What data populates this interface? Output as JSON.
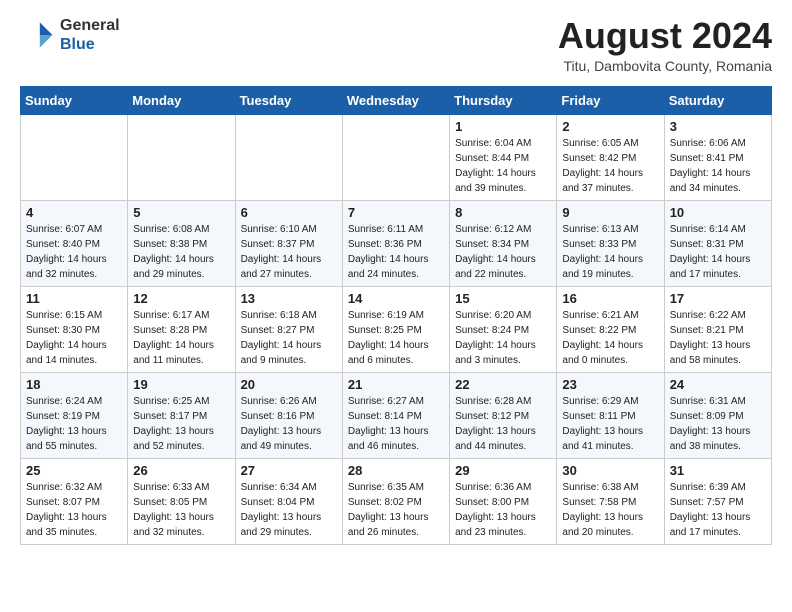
{
  "header": {
    "logo_line1": "General",
    "logo_line2": "Blue",
    "month_year": "August 2024",
    "location": "Titu, Dambovita County, Romania"
  },
  "days_of_week": [
    "Sunday",
    "Monday",
    "Tuesday",
    "Wednesday",
    "Thursday",
    "Friday",
    "Saturday"
  ],
  "weeks": [
    [
      {
        "day": "",
        "info": ""
      },
      {
        "day": "",
        "info": ""
      },
      {
        "day": "",
        "info": ""
      },
      {
        "day": "",
        "info": ""
      },
      {
        "day": "1",
        "info": "Sunrise: 6:04 AM\nSunset: 8:44 PM\nDaylight: 14 hours\nand 39 minutes."
      },
      {
        "day": "2",
        "info": "Sunrise: 6:05 AM\nSunset: 8:42 PM\nDaylight: 14 hours\nand 37 minutes."
      },
      {
        "day": "3",
        "info": "Sunrise: 6:06 AM\nSunset: 8:41 PM\nDaylight: 14 hours\nand 34 minutes."
      }
    ],
    [
      {
        "day": "4",
        "info": "Sunrise: 6:07 AM\nSunset: 8:40 PM\nDaylight: 14 hours\nand 32 minutes."
      },
      {
        "day": "5",
        "info": "Sunrise: 6:08 AM\nSunset: 8:38 PM\nDaylight: 14 hours\nand 29 minutes."
      },
      {
        "day": "6",
        "info": "Sunrise: 6:10 AM\nSunset: 8:37 PM\nDaylight: 14 hours\nand 27 minutes."
      },
      {
        "day": "7",
        "info": "Sunrise: 6:11 AM\nSunset: 8:36 PM\nDaylight: 14 hours\nand 24 minutes."
      },
      {
        "day": "8",
        "info": "Sunrise: 6:12 AM\nSunset: 8:34 PM\nDaylight: 14 hours\nand 22 minutes."
      },
      {
        "day": "9",
        "info": "Sunrise: 6:13 AM\nSunset: 8:33 PM\nDaylight: 14 hours\nand 19 minutes."
      },
      {
        "day": "10",
        "info": "Sunrise: 6:14 AM\nSunset: 8:31 PM\nDaylight: 14 hours\nand 17 minutes."
      }
    ],
    [
      {
        "day": "11",
        "info": "Sunrise: 6:15 AM\nSunset: 8:30 PM\nDaylight: 14 hours\nand 14 minutes."
      },
      {
        "day": "12",
        "info": "Sunrise: 6:17 AM\nSunset: 8:28 PM\nDaylight: 14 hours\nand 11 minutes."
      },
      {
        "day": "13",
        "info": "Sunrise: 6:18 AM\nSunset: 8:27 PM\nDaylight: 14 hours\nand 9 minutes."
      },
      {
        "day": "14",
        "info": "Sunrise: 6:19 AM\nSunset: 8:25 PM\nDaylight: 14 hours\nand 6 minutes."
      },
      {
        "day": "15",
        "info": "Sunrise: 6:20 AM\nSunset: 8:24 PM\nDaylight: 14 hours\nand 3 minutes."
      },
      {
        "day": "16",
        "info": "Sunrise: 6:21 AM\nSunset: 8:22 PM\nDaylight: 14 hours\nand 0 minutes."
      },
      {
        "day": "17",
        "info": "Sunrise: 6:22 AM\nSunset: 8:21 PM\nDaylight: 13 hours\nand 58 minutes."
      }
    ],
    [
      {
        "day": "18",
        "info": "Sunrise: 6:24 AM\nSunset: 8:19 PM\nDaylight: 13 hours\nand 55 minutes."
      },
      {
        "day": "19",
        "info": "Sunrise: 6:25 AM\nSunset: 8:17 PM\nDaylight: 13 hours\nand 52 minutes."
      },
      {
        "day": "20",
        "info": "Sunrise: 6:26 AM\nSunset: 8:16 PM\nDaylight: 13 hours\nand 49 minutes."
      },
      {
        "day": "21",
        "info": "Sunrise: 6:27 AM\nSunset: 8:14 PM\nDaylight: 13 hours\nand 46 minutes."
      },
      {
        "day": "22",
        "info": "Sunrise: 6:28 AM\nSunset: 8:12 PM\nDaylight: 13 hours\nand 44 minutes."
      },
      {
        "day": "23",
        "info": "Sunrise: 6:29 AM\nSunset: 8:11 PM\nDaylight: 13 hours\nand 41 minutes."
      },
      {
        "day": "24",
        "info": "Sunrise: 6:31 AM\nSunset: 8:09 PM\nDaylight: 13 hours\nand 38 minutes."
      }
    ],
    [
      {
        "day": "25",
        "info": "Sunrise: 6:32 AM\nSunset: 8:07 PM\nDaylight: 13 hours\nand 35 minutes."
      },
      {
        "day": "26",
        "info": "Sunrise: 6:33 AM\nSunset: 8:05 PM\nDaylight: 13 hours\nand 32 minutes."
      },
      {
        "day": "27",
        "info": "Sunrise: 6:34 AM\nSunset: 8:04 PM\nDaylight: 13 hours\nand 29 minutes."
      },
      {
        "day": "28",
        "info": "Sunrise: 6:35 AM\nSunset: 8:02 PM\nDaylight: 13 hours\nand 26 minutes."
      },
      {
        "day": "29",
        "info": "Sunrise: 6:36 AM\nSunset: 8:00 PM\nDaylight: 13 hours\nand 23 minutes."
      },
      {
        "day": "30",
        "info": "Sunrise: 6:38 AM\nSunset: 7:58 PM\nDaylight: 13 hours\nand 20 minutes."
      },
      {
        "day": "31",
        "info": "Sunrise: 6:39 AM\nSunset: 7:57 PM\nDaylight: 13 hours\nand 17 minutes."
      }
    ]
  ]
}
